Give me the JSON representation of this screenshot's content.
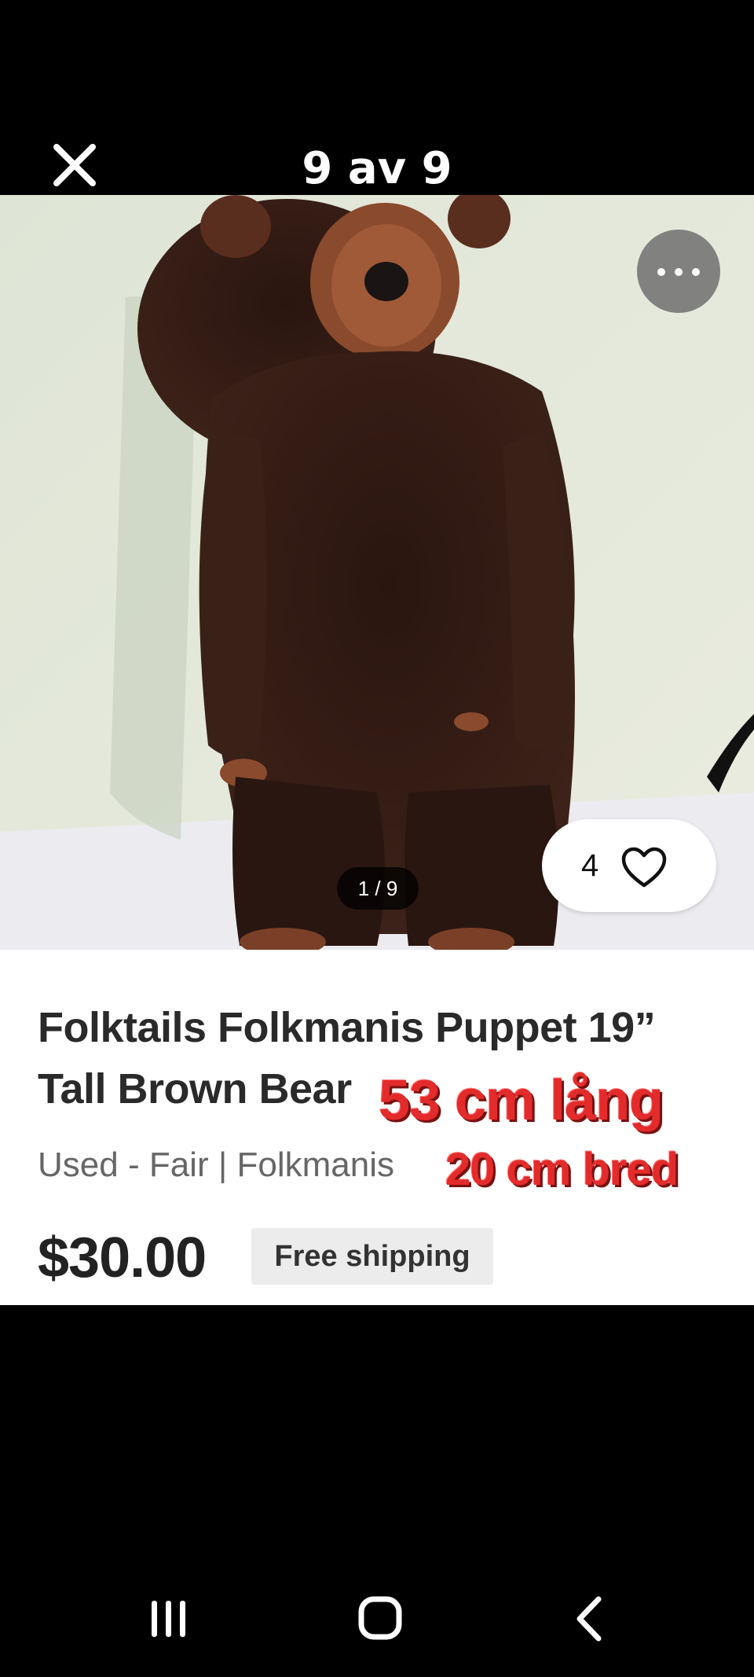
{
  "viewer": {
    "counter": "9 av 9"
  },
  "photo": {
    "pager": "1 / 9",
    "likes": "4"
  },
  "listing": {
    "title": "Folktails Folkmanis Puppet 19” Tall Brown Bear",
    "overlay_length": "53 cm lång",
    "condition_brand": "Used - Fair | Folkmanis",
    "overlay_width": "20 cm bred",
    "price": "$30.00",
    "shipping_badge": "Free shipping"
  },
  "icons": {
    "close": "close-icon",
    "more": "more-horizontal-icon",
    "like": "heart-outline-icon",
    "recents": "recent-apps-icon",
    "home": "home-icon",
    "back": "back-chevron-icon"
  },
  "colors": {
    "overlay_text": "#e32b2b",
    "page_background": "#000000",
    "card_background": "#ffffff"
  }
}
